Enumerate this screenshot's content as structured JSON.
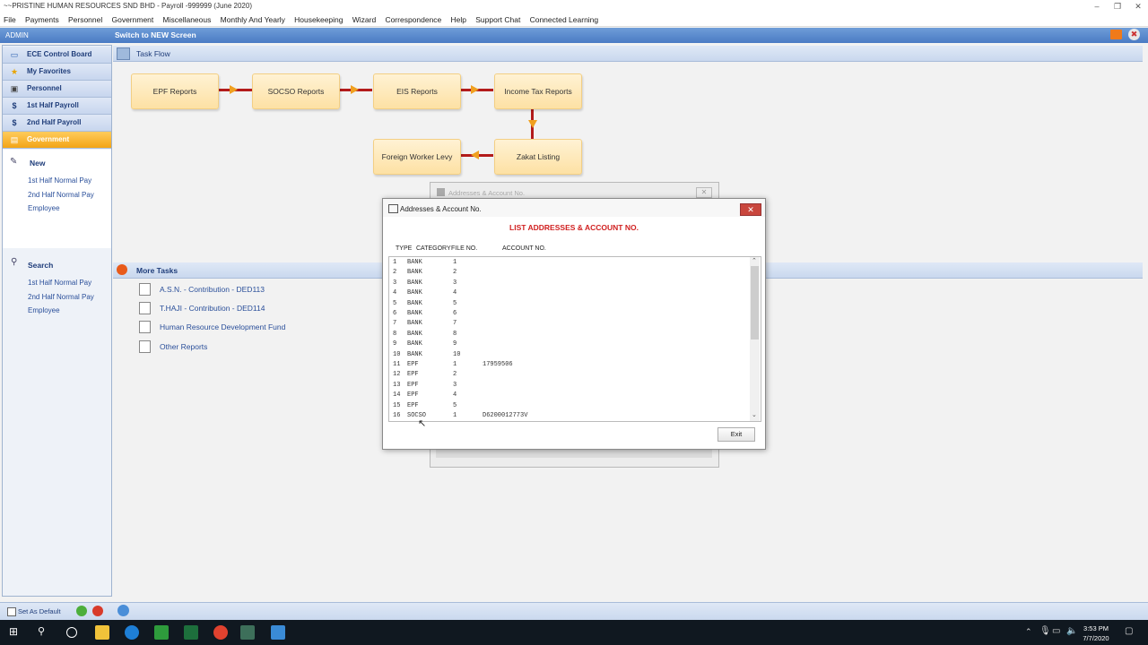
{
  "window": {
    "title": "~~PRISTINE HUMAN RESOURCES SND BHD - Payroll -999999 (June 2020)"
  },
  "menu": [
    "File",
    "Payments",
    "Personnel",
    "Government",
    "Miscellaneous",
    "Monthly And Yearly",
    "Housekeeping",
    "Wizard",
    "Correspondence",
    "Help",
    "Support Chat",
    "Connected Learning"
  ],
  "header": {
    "user": "ADMIN",
    "switch_label": "Switch to NEW Screen"
  },
  "sidebar": {
    "items": [
      {
        "label": "ECE Control Board",
        "icon": "monitor-icon"
      },
      {
        "label": "My Favorites",
        "icon": "star-icon"
      },
      {
        "label": "Personnel",
        "icon": "person-card-icon"
      },
      {
        "label": "1st  Half Payroll",
        "icon": "dollar-icon"
      },
      {
        "label": "2nd Half Payroll",
        "icon": "dollar-icon"
      },
      {
        "label": "Government",
        "icon": "document-icon"
      }
    ],
    "new": {
      "title": "New",
      "links": [
        "1st  Half Normal Pay",
        "2nd Half Normal Pay",
        "Employee"
      ]
    },
    "search": {
      "title": "Search",
      "links": [
        "1st  Half Normal Pay",
        "2nd Half Normal Pay",
        "Employee"
      ]
    },
    "set_default": "Set As Default"
  },
  "taskflow": {
    "title": "Task Flow",
    "boxes": [
      "EPF Reports",
      "SOCSO Reports",
      "EIS Reports",
      "Income Tax Reports",
      "Zakat Listing",
      "Foreign Worker Levy"
    ]
  },
  "more_tasks": {
    "title": "More Tasks",
    "links": [
      "A.S.N. - Contribution - DED113",
      "T.HAJI - Contribution - DED114",
      "Human Resource Development Fund",
      "Other Reports"
    ]
  },
  "bg_dialog": {
    "title": "Addresses & Account No."
  },
  "dialog": {
    "title": "Addresses & Account No.",
    "heading": "LIST ADDRESSES & ACCOUNT NO.",
    "columns": [
      "TYPE",
      "CATEGORY",
      "FILE NO.",
      "ACCOUNT NO."
    ],
    "rows": [
      {
        "n": "1",
        "cat": "BANK",
        "file": "1",
        "acc": ""
      },
      {
        "n": "2",
        "cat": "BANK",
        "file": "2",
        "acc": ""
      },
      {
        "n": "3",
        "cat": "BANK",
        "file": "3",
        "acc": ""
      },
      {
        "n": "4",
        "cat": "BANK",
        "file": "4",
        "acc": ""
      },
      {
        "n": "5",
        "cat": "BANK",
        "file": "5",
        "acc": ""
      },
      {
        "n": "6",
        "cat": "BANK",
        "file": "6",
        "acc": ""
      },
      {
        "n": "7",
        "cat": "BANK",
        "file": "7",
        "acc": ""
      },
      {
        "n": "8",
        "cat": "BANK",
        "file": "8",
        "acc": ""
      },
      {
        "n": "9",
        "cat": "BANK",
        "file": "9",
        "acc": ""
      },
      {
        "n": "10",
        "cat": "BANK",
        "file": "10",
        "acc": ""
      },
      {
        "n": "11",
        "cat": "EPF",
        "file": "1",
        "acc": "17959506"
      },
      {
        "n": "12",
        "cat": "EPF",
        "file": "2",
        "acc": ""
      },
      {
        "n": "13",
        "cat": "EPF",
        "file": "3",
        "acc": ""
      },
      {
        "n": "14",
        "cat": "EPF",
        "file": "4",
        "acc": ""
      },
      {
        "n": "15",
        "cat": "EPF",
        "file": "5",
        "acc": ""
      },
      {
        "n": "16",
        "cat": "SOCSO",
        "file": "1",
        "acc": "D6200012773V"
      }
    ],
    "exit_label": "Exit"
  },
  "taskbar": {
    "time": "3:53 PM",
    "date": "7/7/2020"
  },
  "colors": {
    "accent": "#f3a516",
    "nav_text": "#1f3d7a",
    "heading_red": "#d01f1f",
    "flow_arrow": "#b31b1b"
  }
}
